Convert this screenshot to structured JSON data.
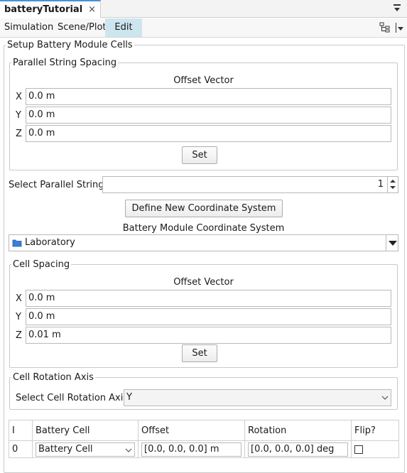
{
  "tab": {
    "title": "batteryTutorial",
    "close_glyph": "×"
  },
  "menu": {
    "simulation": "Simulation",
    "scene_plot": "Scene/Plot",
    "edit": "Edit"
  },
  "panel": {
    "title": "Setup Battery Module Cells"
  },
  "parallel_string_spacing": {
    "title": "Parallel String Spacing",
    "offset_label": "Offset Vector",
    "x_label": "X",
    "x_value": "0.0 m",
    "y_label": "Y",
    "y_value": "0.0 m",
    "z_label": "Z",
    "z_value": "0.0 m",
    "set_label": "Set"
  },
  "select_parallel_string": {
    "label": "Select Parallel String",
    "value": "1"
  },
  "define_cs_button": "Define New Coordinate System",
  "module_cs": {
    "label": "Battery Module Coordinate System",
    "value": "Laboratory",
    "icon": "folder-icon"
  },
  "cell_spacing": {
    "title": "Cell Spacing",
    "offset_label": "Offset Vector",
    "x_label": "X",
    "x_value": "0.0 m",
    "y_label": "Y",
    "y_value": "0.0 m",
    "z_label": "Z",
    "z_value": "0.01 m",
    "set_label": "Set"
  },
  "cell_rotation": {
    "title": "Cell Rotation Axis",
    "label": "Select Cell Rotation Axis",
    "value": "Y"
  },
  "table": {
    "headers": [
      "I",
      "Battery Cell",
      "Offset",
      "Rotation",
      "Flip?"
    ],
    "rows": [
      {
        "index": "0",
        "cell": "Battery Cell",
        "offset": "[0.0, 0.0, 0.0] m",
        "rotation": "[0.0, 0.0, 0.0] deg",
        "flip": false
      }
    ]
  },
  "colors": {
    "menu_active_bg": "#cde5ee",
    "tab_accent": "#4a90d9",
    "folder": "#3b7fd6"
  }
}
